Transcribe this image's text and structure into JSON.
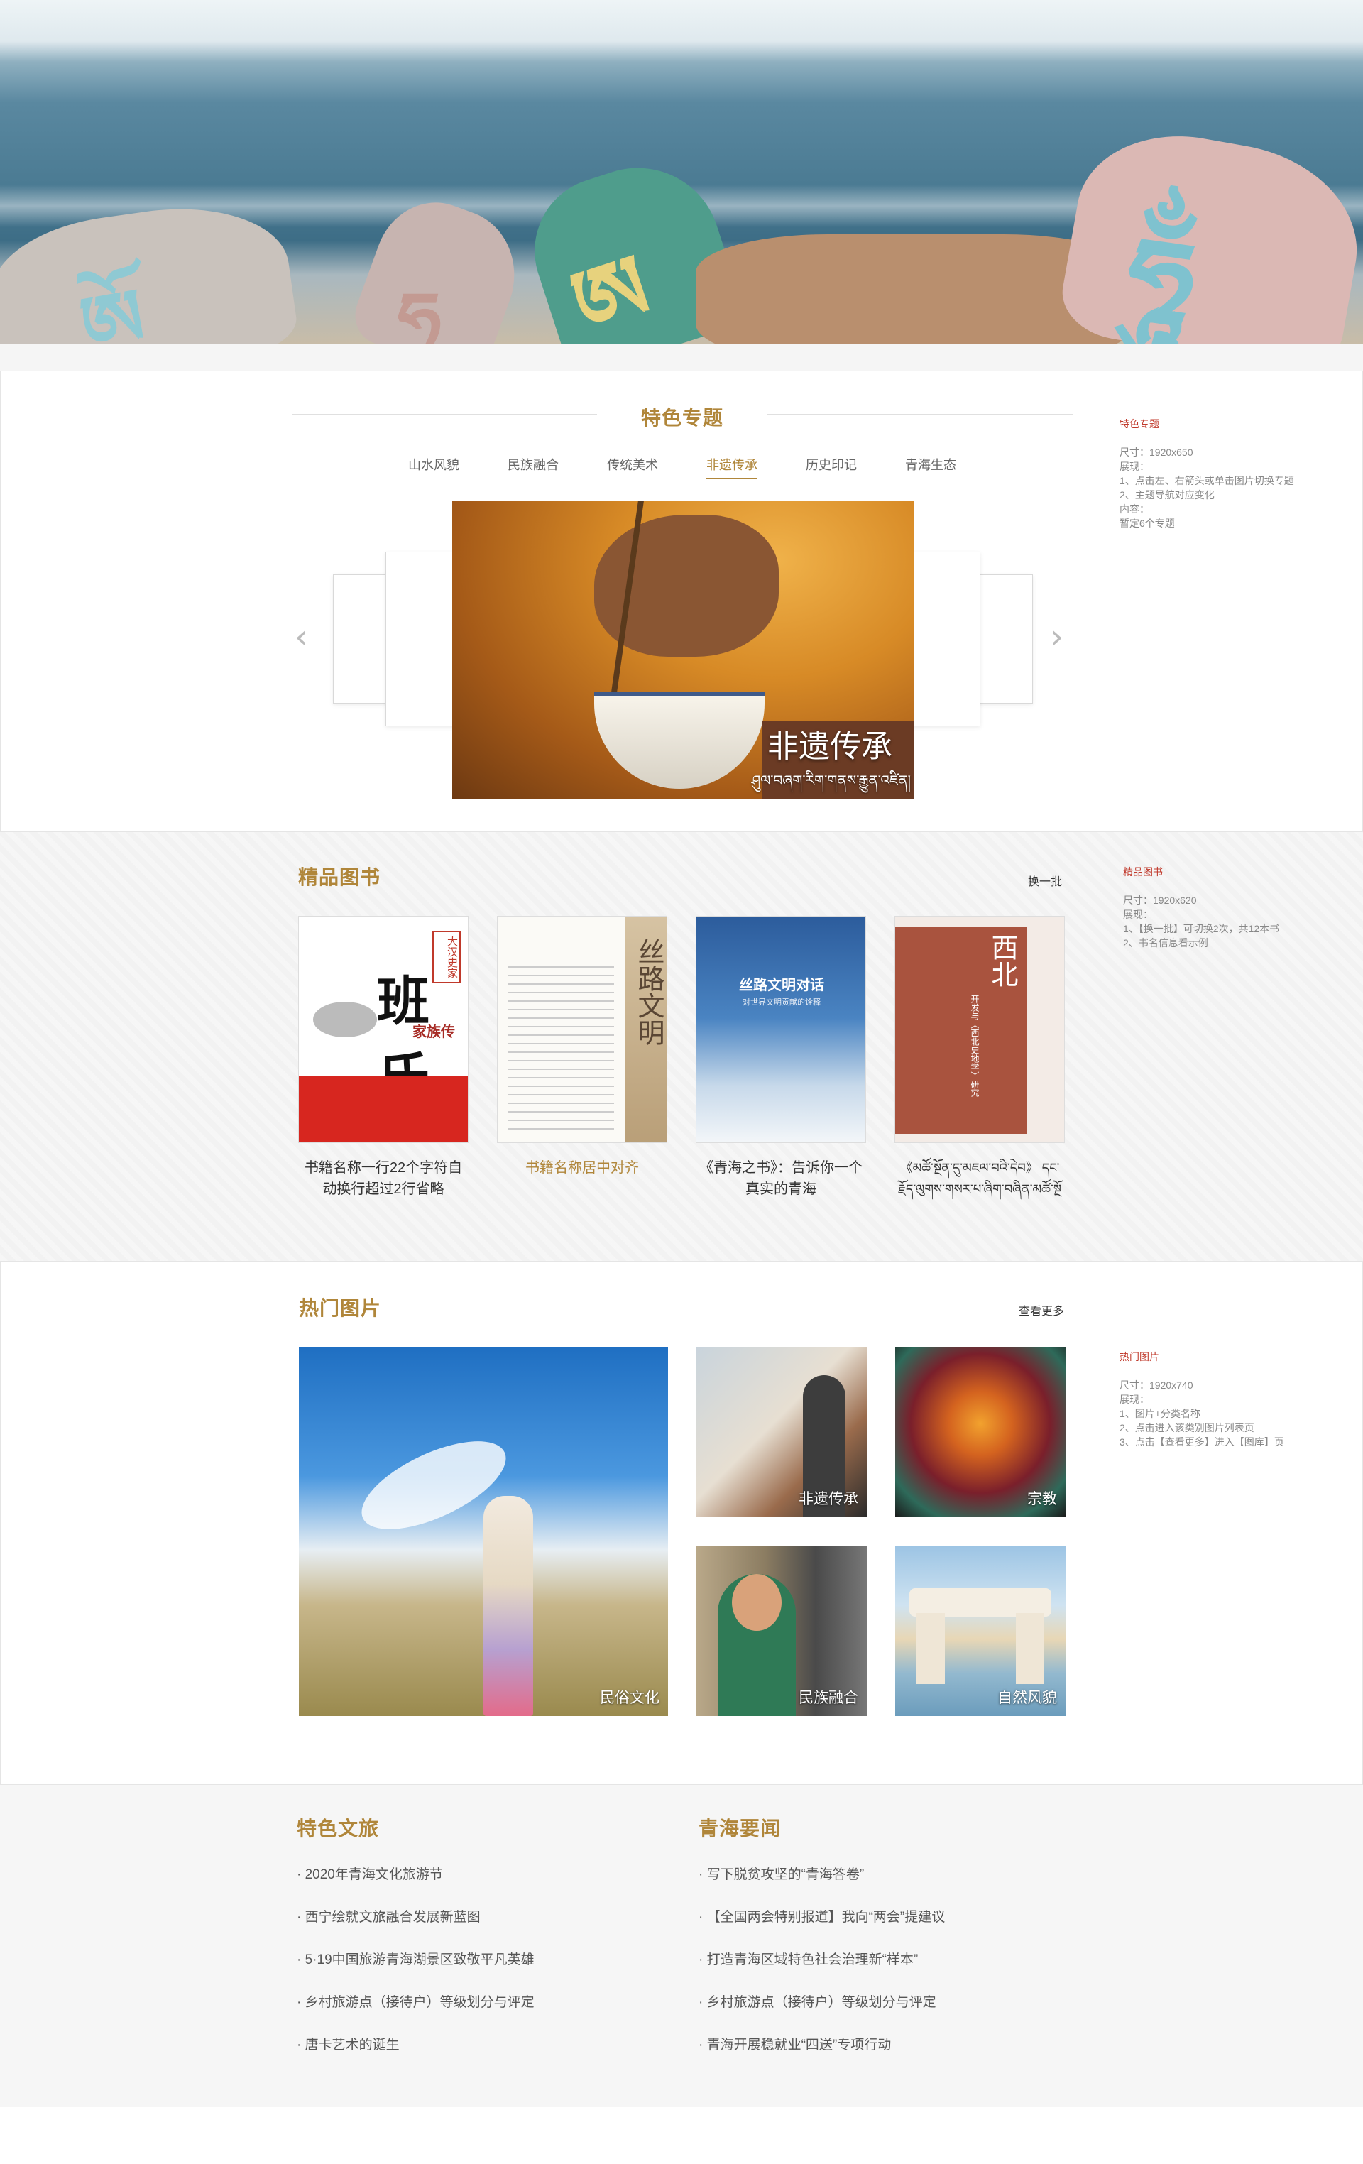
{
  "featured": {
    "title": "特色专题",
    "tabs": [
      "山水风貌",
      "民族融合",
      "传统美术",
      "非遗传承",
      "历史印记",
      "青海生态"
    ],
    "active_tab": "非遗传承",
    "slide": {
      "title": "非遗传承",
      "subtitle": "ཤུལ་བཞག་རིག་གནས་རྒྱུན་འཛིན།"
    },
    "note": {
      "heading": "特色专题",
      "lines": [
        "尺寸：1920x650",
        "展现：",
        "1、点击左、右箭头或单击图片切换专题",
        "2、主题导航对应变化",
        "内容：",
        "暂定6个专题"
      ]
    }
  },
  "books": {
    "title": "精品图书",
    "refresh_label": "换一批",
    "items": [
      {
        "name": "书籍名称一行22个字符自动换行超过2行省略",
        "cover_big": "班氏",
        "cover_sub": "家族传",
        "cover_tag": "大汉史家",
        "highlight": false
      },
      {
        "name": "书籍名称居中对齐",
        "cover_big": "丝路文明",
        "highlight": true
      },
      {
        "name": "《青海之书》：告诉你一个真实的青海",
        "cover_big": "丝路文明对话",
        "cover_sub": "对世界文明贡献的诠释",
        "highlight": false
      },
      {
        "name": "《མཚོ་སྔོན་དུ་མཇལ་བའི་དེབ》 དང་རྗོད་ལུགས་གསར་པ་ཞིག་བཞིན་མཚོ་སྔོ",
        "cover_big": "西北",
        "cover_sub": "开发与〈西北史地学〉研究",
        "highlight": false
      }
    ],
    "note": {
      "heading": "精品图书",
      "lines": [
        "尺寸：1920x620",
        "展现：",
        "1、【换一批】可切换2次，共12本书",
        "2、书名信息看示例"
      ]
    }
  },
  "pictures": {
    "title": "热门图片",
    "more_label": "查看更多",
    "items": [
      {
        "caption": "民俗文化"
      },
      {
        "caption": "非遗传承"
      },
      {
        "caption": "宗教"
      },
      {
        "caption": "民族融合"
      },
      {
        "caption": "自然风貌"
      }
    ],
    "note": {
      "heading": "热门图片",
      "lines": [
        "尺寸：1920x740",
        "展现：",
        "1、图片+分类名称",
        "2、点击进入该类别图片列表页",
        "3、点击【查看更多】进入【图库】页"
      ]
    }
  },
  "news": {
    "left_title": "特色文旅",
    "left_items": [
      "· 2020年青海文化旅游节",
      "· 西宁绘就文旅融合发展新蓝图",
      "· 5·19中国旅游青海湖景区致敬平凡英雄",
      "· 乡村旅游点（接待户）等级划分与评定",
      "· 唐卡艺术的诞生"
    ],
    "right_title": "青海要闻",
    "right_items": [
      "· 写下脱贫攻坚的“青海答卷”",
      "· 【全国两会特别报道】我向“两会”提建议",
      "· 打造青海区域特色社会治理新“样本”",
      "· 乡村旅游点（接待户）等级划分与评定",
      "· 青海开展稳就业“四送”专项行动"
    ]
  }
}
